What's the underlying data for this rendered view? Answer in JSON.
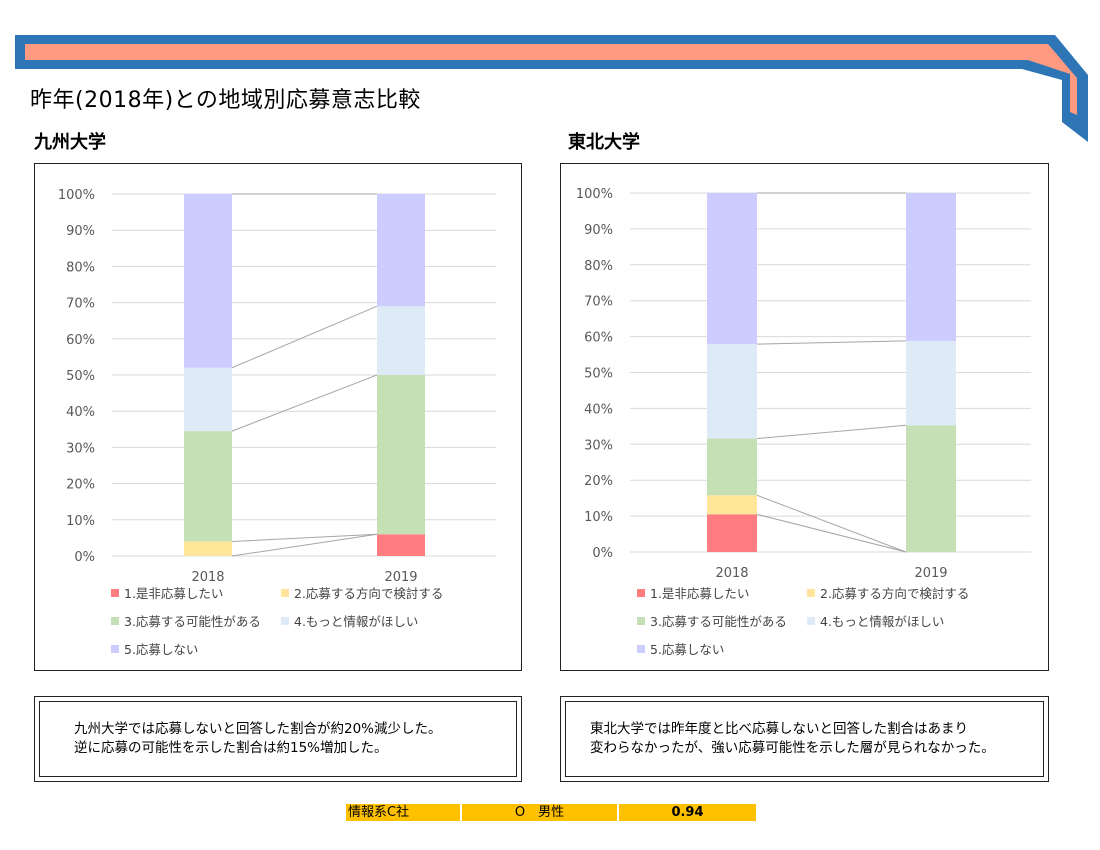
{
  "page": {
    "title": "昨年(2018年)との地域別応募意志比較",
    "colors": {
      "banner_blue": "#2e75b6",
      "banner_salmon": "#ff9a80",
      "footer_gold": "#ffc000"
    }
  },
  "legend_items": [
    {
      "label": "1.是非応募したい",
      "color": "#ff7c80"
    },
    {
      "label": "2.応募する方向で検討する",
      "color": "#ffe699"
    },
    {
      "label": "3.応募する可能性がある",
      "color": "#c5e0b4"
    },
    {
      "label": "4.もっと情報がほしい",
      "color": "#deebf7"
    },
    {
      "label": "5.応募しない",
      "color": "#ccccff"
    }
  ],
  "chart_data": [
    {
      "type": "bar",
      "stacked": true,
      "percent": true,
      "title": "九州大学",
      "categories": [
        "2018",
        "2019"
      ],
      "ylim": [
        0,
        100
      ],
      "yticks": [
        "0%",
        "10%",
        "20%",
        "30%",
        "40%",
        "50%",
        "60%",
        "70%",
        "80%",
        "90%",
        "100%"
      ],
      "grid": true,
      "legend_position": "bottom",
      "series": [
        {
          "name": "1.是非応募したい",
          "values": [
            0,
            6
          ],
          "color": "#ff7c80"
        },
        {
          "name": "2.応募する方向で検討する",
          "values": [
            4,
            0
          ],
          "color": "#ffe699"
        },
        {
          "name": "3.応募する可能性がある",
          "values": [
            30.5,
            44
          ],
          "color": "#c5e0b4"
        },
        {
          "name": "4.もっと情報がほしい",
          "values": [
            17.5,
            19
          ],
          "color": "#deebf7"
        },
        {
          "name": "5.応募しない",
          "values": [
            48,
            31
          ],
          "color": "#ccccff"
        }
      ]
    },
    {
      "type": "bar",
      "stacked": true,
      "percent": true,
      "title": "東北大学",
      "categories": [
        "2018",
        "2019"
      ],
      "ylim": [
        0,
        100
      ],
      "yticks": [
        "0%",
        "10%",
        "20%",
        "30%",
        "40%",
        "50%",
        "60%",
        "70%",
        "80%",
        "90%",
        "100%"
      ],
      "grid": true,
      "legend_position": "bottom",
      "series": [
        {
          "name": "1.是非応募したい",
          "values": [
            10.5,
            0
          ],
          "color": "#ff7c80"
        },
        {
          "name": "2.応募する方向で検討する",
          "values": [
            5.3,
            0
          ],
          "color": "#ffe699"
        },
        {
          "name": "3.応募する可能性がある",
          "values": [
            15.8,
            35.3
          ],
          "color": "#c5e0b4"
        },
        {
          "name": "4.もっと情報がほしい",
          "values": [
            26.3,
            23.5
          ],
          "color": "#deebf7"
        },
        {
          "name": "5.応募しない",
          "values": [
            42.1,
            41.2
          ],
          "color": "#ccccff"
        }
      ]
    }
  ],
  "notes": {
    "kyushu": [
      "九州大学では応募しないと回答した割合が約20%減少した。",
      "逆に応募の可能性を示した割合は約15%増加した。"
    ],
    "tohoku": [
      "東北大学では昨年度と比べ応募しないと回答した割合はあまり",
      "変わらなかったが、強い応募可能性を示した層が見られなかった。"
    ]
  },
  "footer": {
    "company": "情報系C社",
    "person": "O　男性",
    "score": "0.94"
  }
}
